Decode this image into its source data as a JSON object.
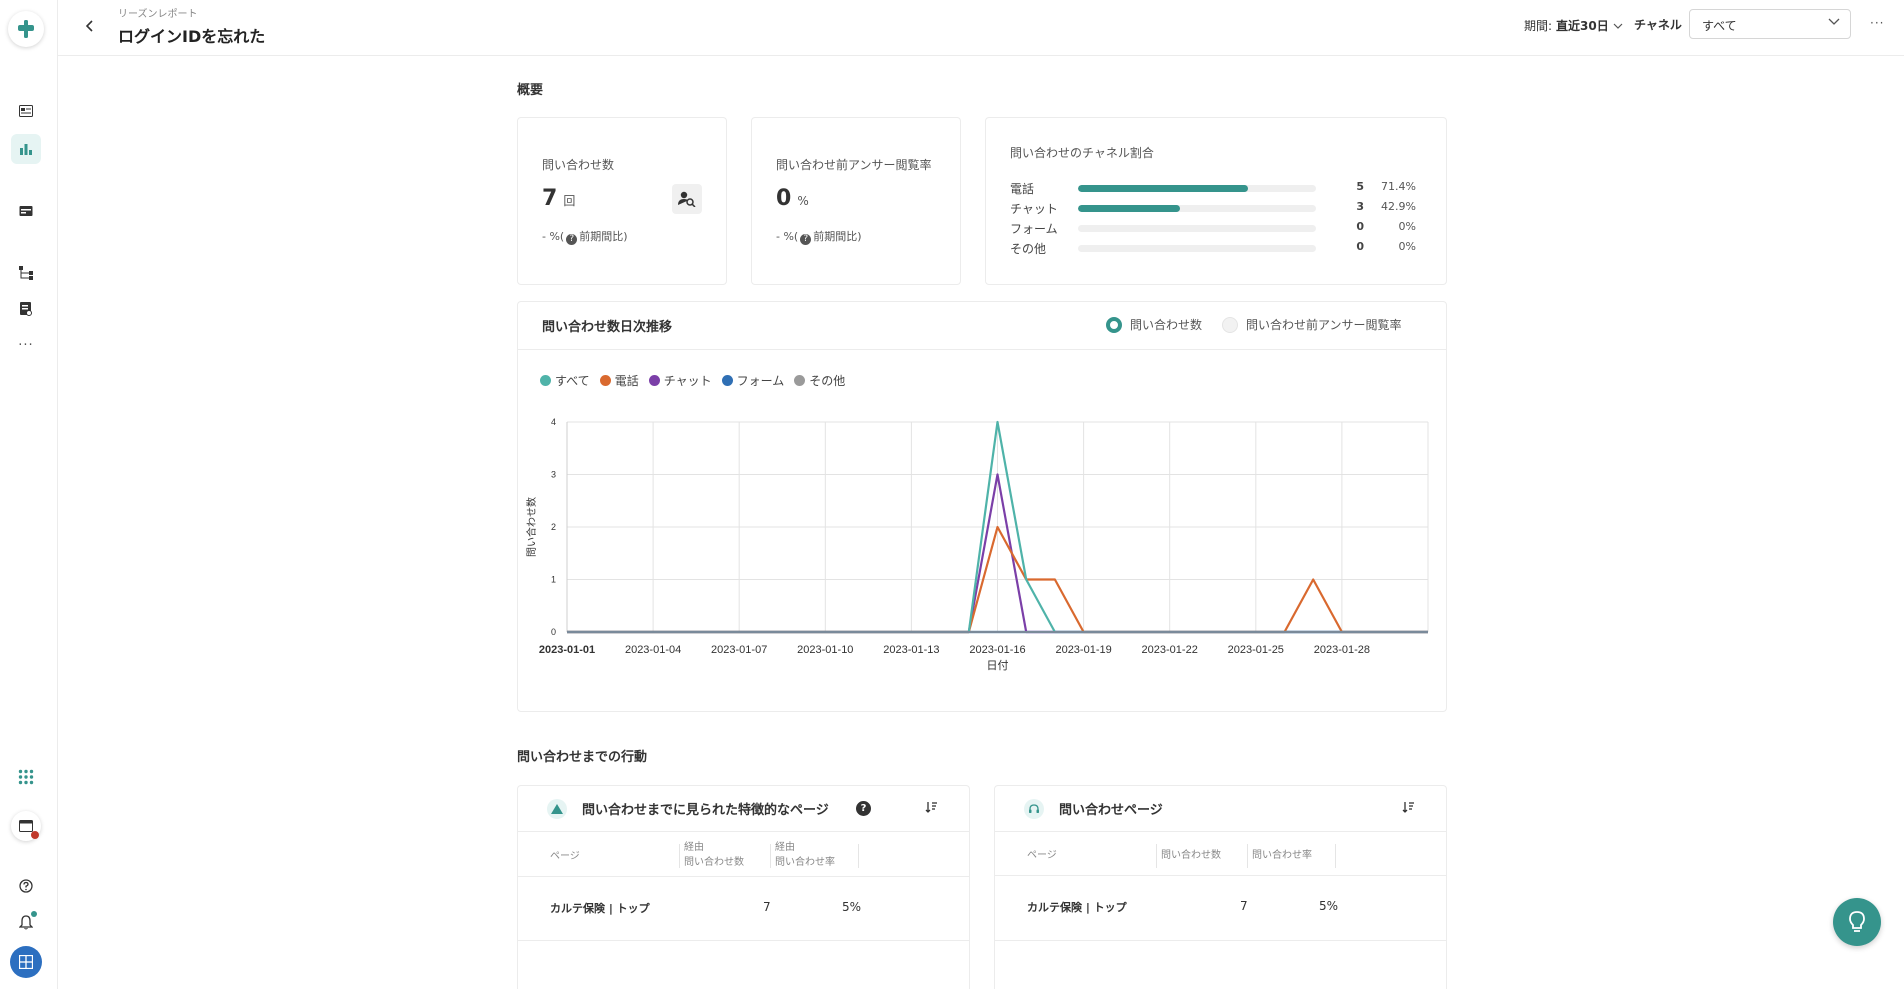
{
  "header": {
    "breadcrumb": "リーズンレポート",
    "title": "ログインIDを忘れた",
    "period_prefix": "期間:",
    "period_value": "直近30日",
    "channel_label": "チャネル",
    "channel_value": "すべて",
    "more": "···"
  },
  "sidebar": {
    "items": [
      "logo-icon",
      "inbox-icon",
      "bar-chart-icon",
      "card-icon",
      "flow-icon",
      "document-icon",
      "more-icon",
      "apps-icon",
      "window-icon",
      "help-icon",
      "bell-icon",
      "grid-icon"
    ],
    "more": "···"
  },
  "overview": {
    "section_title": "概要",
    "inquiries": {
      "label": "問い合わせ数",
      "value": "7",
      "unit": "回",
      "delta": "-  %(",
      "delta_suffix": "前期間比)"
    },
    "view_rate": {
      "label": "問い合わせ前アンサー閲覧率",
      "value": "0",
      "unit": "%",
      "delta": "-  %(",
      "delta_suffix": "前期間比)"
    },
    "channel_ratio": {
      "title": "問い合わせのチャネル割合",
      "rows": [
        {
          "name": "電話",
          "count": "5",
          "pct": "71.4%",
          "fraction": 0.714
        },
        {
          "name": "チャット",
          "count": "3",
          "pct": "42.9%",
          "fraction": 0.429
        },
        {
          "name": "フォーム",
          "count": "0",
          "pct": "0%",
          "fraction": 0
        },
        {
          "name": "その他",
          "count": "0",
          "pct": "0%",
          "fraction": 0
        }
      ]
    }
  },
  "trend": {
    "title": "問い合わせ数日次推移",
    "radio_on": "問い合わせ数",
    "radio_off": "問い合わせ前アンサー閲覧率"
  },
  "chart_data": {
    "type": "line",
    "xlabel": "日付",
    "ylabel": "問い合わせ数",
    "ylim": [
      0,
      4
    ],
    "yticks": [
      "0",
      "1",
      "2",
      "3",
      "4"
    ],
    "xtick_labels": [
      "2023-01-01",
      "2023-01-04",
      "2023-01-07",
      "2023-01-10",
      "2023-01-13",
      "2023-01-16",
      "2023-01-19",
      "2023-01-22",
      "2023-01-25",
      "2023-01-28"
    ],
    "x": [
      "2023-01-01",
      "2023-01-02",
      "2023-01-03",
      "2023-01-04",
      "2023-01-05",
      "2023-01-06",
      "2023-01-07",
      "2023-01-08",
      "2023-01-09",
      "2023-01-10",
      "2023-01-11",
      "2023-01-12",
      "2023-01-13",
      "2023-01-14",
      "2023-01-15",
      "2023-01-16",
      "2023-01-17",
      "2023-01-18",
      "2023-01-19",
      "2023-01-20",
      "2023-01-21",
      "2023-01-22",
      "2023-01-23",
      "2023-01-24",
      "2023-01-25",
      "2023-01-26",
      "2023-01-27",
      "2023-01-28",
      "2023-01-29",
      "2023-01-30",
      "2023-01-31"
    ],
    "grid": true,
    "legend_position": "top-left",
    "series": [
      {
        "name": "すべて",
        "color": "#4fb3a9",
        "values": [
          0,
          0,
          0,
          0,
          0,
          0,
          0,
          0,
          0,
          0,
          0,
          0,
          0,
          0,
          0,
          4,
          1,
          0,
          0,
          0,
          0,
          0,
          0,
          0,
          0,
          0,
          0,
          0,
          0,
          0,
          0
        ]
      },
      {
        "name": "電話",
        "color": "#d9692f",
        "values": [
          0,
          0,
          0,
          0,
          0,
          0,
          0,
          0,
          0,
          0,
          0,
          0,
          0,
          0,
          0,
          2,
          1,
          1,
          0,
          0,
          0,
          0,
          0,
          0,
          0,
          0,
          1,
          0,
          0,
          0,
          0
        ]
      },
      {
        "name": "チャット",
        "color": "#7b3fa8",
        "values": [
          0,
          0,
          0,
          0,
          0,
          0,
          0,
          0,
          0,
          0,
          0,
          0,
          0,
          0,
          0,
          3,
          0,
          0,
          0,
          0,
          0,
          0,
          0,
          0,
          0,
          0,
          0,
          0,
          0,
          0,
          0
        ]
      },
      {
        "name": "フォーム",
        "color": "#2f6fb4",
        "values": [
          0,
          0,
          0,
          0,
          0,
          0,
          0,
          0,
          0,
          0,
          0,
          0,
          0,
          0,
          0,
          0,
          0,
          0,
          0,
          0,
          0,
          0,
          0,
          0,
          0,
          0,
          0,
          0,
          0,
          0,
          0
        ]
      },
      {
        "name": "その他",
        "color": "#9a9a9a",
        "values": [
          0,
          0,
          0,
          0,
          0,
          0,
          0,
          0,
          0,
          0,
          0,
          0,
          0,
          0,
          0,
          0,
          0,
          0,
          0,
          0,
          0,
          0,
          0,
          0,
          0,
          0,
          0,
          0,
          0,
          0,
          0
        ]
      }
    ]
  },
  "behavior": {
    "section_title": "問い合わせまでの行動",
    "pages_card": {
      "title": "問い合わせまでに見られた特徴的なページ",
      "col_page": "ページ",
      "col_via_count_1": "経由",
      "col_via_count_2": "問い合わせ数",
      "col_via_rate_1": "経由",
      "col_via_rate_2": "問い合わせ率",
      "rows": [
        {
          "page": "カルテ保険 | トップ",
          "count": "7",
          "rate": "5%"
        }
      ]
    },
    "inquiry_pages_card": {
      "title": "問い合わせページ",
      "col_page": "ページ",
      "col_count": "問い合わせ数",
      "col_rate": "問い合わせ率",
      "rows": [
        {
          "page": "カルテ保険 | トップ",
          "count": "7",
          "rate": "5%"
        }
      ]
    }
  }
}
